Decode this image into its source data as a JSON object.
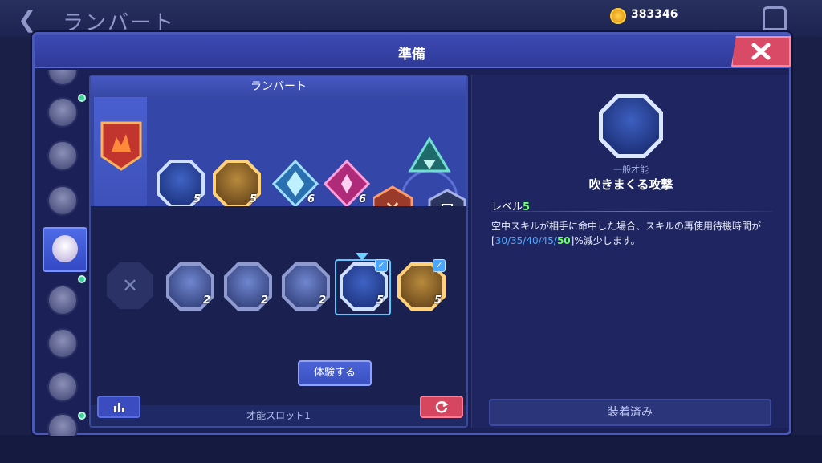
{
  "background": {
    "title": "ランバート",
    "currency_value": "383346",
    "bottom_hint": "体験する"
  },
  "modal": {
    "title": "準備"
  },
  "loadout": {
    "character_name": "ランバート",
    "equipped_talents": [
      {
        "icon": "blow-talent-icon",
        "count": "5"
      },
      {
        "icon": "shell-talent-icon",
        "count": "5"
      }
    ],
    "equipped_gems": [
      {
        "icon": "crystal-gem-icon",
        "count": "6"
      },
      {
        "icon": "pink-gem-icon",
        "count": "6"
      }
    ],
    "slot_label": "才能スロット1"
  },
  "talent_list": [
    {
      "icon": "ghost-talent-icon",
      "count": "2",
      "checked": false
    },
    {
      "icon": "shield-talent-icon",
      "count": "2",
      "checked": false
    },
    {
      "icon": "slash-talent-icon",
      "count": "2",
      "checked": false
    },
    {
      "icon": "blow-talent-icon",
      "count": "5",
      "checked": true
    },
    {
      "icon": "shell-talent-icon",
      "count": "5",
      "checked": true
    }
  ],
  "detail": {
    "type_label": "一般才能",
    "name": "吹きまくる攻撃",
    "level_label": "レベル",
    "level_value": "5",
    "description_part1": "空中スキルが相手に命中した場合、スキルの再使用待機時間が[",
    "description_values": "30/35/40/45/",
    "description_highlight": "50",
    "description_part2": "]%減少します。",
    "try_button": "体験する",
    "equipped_button": "装着済み"
  },
  "colors": {
    "accent_blue": "#4a59b8",
    "highlight_green": "#6dff6a",
    "value_blue": "#4fa8ff",
    "close_red": "#d94a66"
  }
}
